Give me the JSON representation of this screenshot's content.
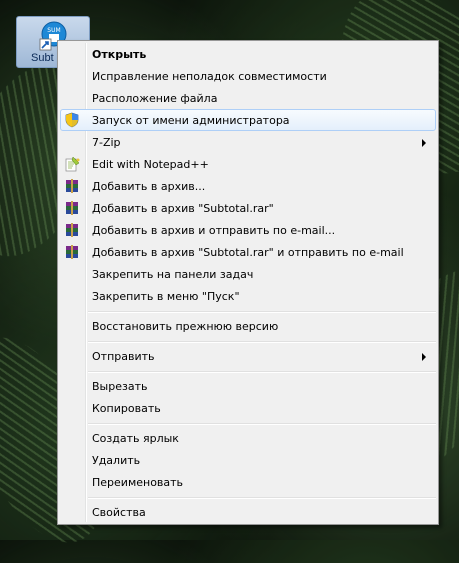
{
  "desktop_icon": {
    "label": "Subt",
    "icon": "shortcut-app-icon"
  },
  "menu": {
    "items": [
      {
        "label": "Открыть",
        "bold": true
      },
      {
        "label": "Исправление неполадок совместимости"
      },
      {
        "label": "Расположение файла"
      },
      {
        "label": "Запуск от имени администратора",
        "icon": "uac-shield-icon",
        "highlighted": true
      },
      {
        "label": "7-Zip",
        "submenu": true
      },
      {
        "label": "Edit with Notepad++",
        "icon": "notepadpp-icon"
      },
      {
        "label": "Добавить в архив...",
        "icon": "winrar-icon"
      },
      {
        "label": "Добавить в архив \"Subtotal.rar\"",
        "icon": "winrar-icon"
      },
      {
        "label": "Добавить в архив и отправить по e-mail...",
        "icon": "winrar-icon"
      },
      {
        "label": "Добавить в архив \"Subtotal.rar\" и отправить по e-mail",
        "icon": "winrar-icon"
      },
      {
        "label": "Закрепить на панели задач"
      },
      {
        "label": "Закрепить в меню \"Пуск\""
      },
      {
        "label": "Восстановить прежнюю версию"
      },
      {
        "label": "Отправить",
        "submenu": true
      },
      {
        "label": "Вырезать"
      },
      {
        "label": "Копировать"
      },
      {
        "label": "Создать ярлык"
      },
      {
        "label": "Удалить"
      },
      {
        "label": "Переименовать"
      },
      {
        "label": "Свойства"
      }
    ]
  },
  "colors": {
    "highlight_border": "#aecff7",
    "menu_bg": "#f0f0f0"
  }
}
